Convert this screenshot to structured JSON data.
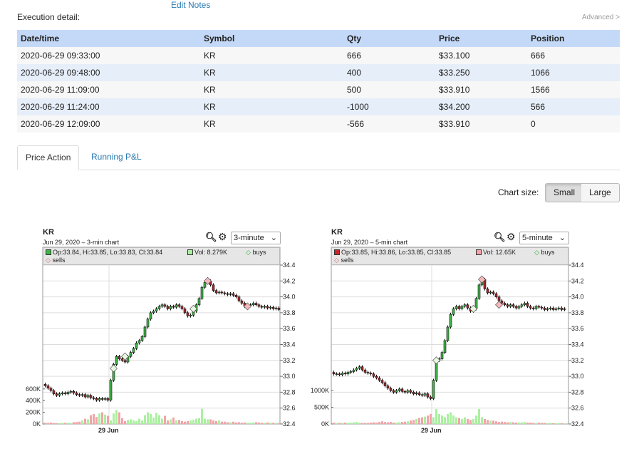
{
  "header": {
    "edit_notes": "Edit Notes",
    "execution_label": "Execution detail:",
    "advanced_link": "Advanced >"
  },
  "table": {
    "columns": [
      "Date/time",
      "Symbol",
      "Qty",
      "Price",
      "Position"
    ],
    "rows": [
      [
        "2020-06-29 09:33:00",
        "KR",
        "666",
        "$33.100",
        "666"
      ],
      [
        "2020-06-29 09:48:00",
        "KR",
        "400",
        "$33.250",
        "1066"
      ],
      [
        "2020-06-29 11:09:00",
        "KR",
        "500",
        "$33.910",
        "1566"
      ],
      [
        "2020-06-29 11:24:00",
        "KR",
        "-1000",
        "$34.200",
        "566"
      ],
      [
        "2020-06-29 12:09:00",
        "KR",
        "-566",
        "$33.910",
        "0"
      ]
    ]
  },
  "tabs": [
    {
      "label": "Price Action",
      "active": true
    },
    {
      "label": "Running P&L",
      "active": false
    }
  ],
  "chart_size": {
    "label": "Chart size:",
    "options": [
      "Small",
      "Large"
    ],
    "selected": "Small"
  },
  "colors": {
    "up": "#3fb548",
    "down": "#a8282c",
    "vol_up": "#aaf0a0",
    "vol_down": "#f2a4a8",
    "header_row": "#c4d9f7",
    "link": "#2a7ab0"
  },
  "chart_data": [
    {
      "type": "candlestick",
      "symbol": "KR",
      "subtitle": "Jun 29, 2020 – 3-min chart",
      "interval": "3-minute",
      "legend": {
        "ohlc": "Op:33.84, Hi:33.85, Lo:33.83, Cl:33.84",
        "vol": "Vol: 8.279K",
        "buys": "buys",
        "sells": "sells",
        "last_color": "#3fb548",
        "last_vol_color": "#aaf0a0"
      },
      "y_ticks": [
        "34.4",
        "34.2",
        "34.0",
        "33.8",
        "33.6",
        "33.4",
        "33.2",
        "33.0",
        "32.8",
        "32.6",
        "32.4"
      ],
      "ylim": [
        32.4,
        34.4
      ],
      "vol_ticks": [
        "600K",
        "400K",
        "200K",
        "0K"
      ],
      "x_label": "29 Jun",
      "premarket_bars": 23,
      "close": [
        32.88,
        32.85,
        32.82,
        32.78,
        32.76,
        32.78,
        32.79,
        32.78,
        32.8,
        32.81,
        32.79,
        32.77,
        32.76,
        32.77,
        32.74,
        32.76,
        32.73,
        32.72,
        32.7,
        32.72,
        32.71,
        32.72,
        32.7,
        32.95,
        33.15,
        33.25,
        33.22,
        33.2,
        33.18,
        33.25,
        33.3,
        33.35,
        33.42,
        33.45,
        33.5,
        33.62,
        33.72,
        33.8,
        33.82,
        33.85,
        33.88,
        33.9,
        33.88,
        33.85,
        33.88,
        33.87,
        33.9,
        33.88,
        33.85,
        33.8,
        33.76,
        33.77,
        33.82,
        33.9,
        33.98,
        34.12,
        34.18,
        34.2,
        34.15,
        34.08,
        34.05,
        34.06,
        34.05,
        34.04,
        34.03,
        34.04,
        34.02,
        34.0,
        33.95,
        33.92,
        33.88,
        33.9,
        33.9,
        33.92,
        33.9,
        33.88,
        33.87,
        33.88,
        33.86,
        33.87,
        33.85,
        33.86,
        33.84
      ],
      "volume_k": [
        20,
        18,
        25,
        15,
        12,
        15,
        18,
        20,
        22,
        15,
        30,
        35,
        40,
        60,
        90,
        80,
        150,
        170,
        120,
        180,
        200,
        160,
        140,
        60,
        180,
        240,
        200,
        100,
        50,
        70,
        80,
        60,
        50,
        90,
        60,
        150,
        200,
        170,
        110,
        190,
        150,
        90,
        140,
        60,
        80,
        110,
        60,
        70,
        50,
        40,
        50,
        60,
        70,
        90,
        100,
        260,
        90,
        80,
        80,
        60,
        50,
        60,
        40,
        40,
        30,
        30,
        40,
        25,
        30,
        20,
        25,
        20,
        20,
        25,
        30,
        25,
        20,
        20,
        25,
        20,
        18,
        20,
        15
      ],
      "buys": [
        {
          "bar": 24,
          "price": 33.1
        },
        {
          "bar": 28,
          "price": 33.25
        },
        {
          "bar": 52,
          "price": 33.85
        }
      ],
      "sells": [
        {
          "bar": 57,
          "price": 34.2
        },
        {
          "bar": 71,
          "price": 33.88
        }
      ]
    },
    {
      "type": "candlestick",
      "symbol": "KR",
      "subtitle": "Jun 29, 2020 – 5-min chart",
      "interval": "5-minute",
      "legend": {
        "ohlc": "Op:33.85, Hi:33.86, Lo:33.85, Cl:33.85",
        "vol": "Vol: 12.65K",
        "buys": "buys",
        "sells": "sells",
        "last_color": "#c8282c",
        "last_vol_color": "#f2a4a8"
      },
      "y_ticks": [
        "34.4",
        "34.2",
        "34.0",
        "33.8",
        "33.6",
        "33.4",
        "33.2",
        "33.0",
        "32.8",
        "32.6",
        "32.4"
      ],
      "ylim": [
        32.4,
        34.4
      ],
      "vol_ticks": [
        "1000K",
        "500K",
        "0K"
      ],
      "x_label": "29 Jun",
      "premarket_bars": 35,
      "close": [
        33.03,
        33.03,
        33.02,
        33.04,
        33.03,
        33.05,
        33.06,
        33.08,
        33.1,
        33.12,
        33.08,
        33.05,
        33.04,
        33.03,
        33.0,
        32.98,
        32.95,
        32.92,
        32.88,
        32.85,
        32.82,
        32.8,
        32.82,
        32.84,
        32.81,
        32.8,
        32.82,
        32.8,
        32.78,
        32.79,
        32.77,
        32.76,
        32.78,
        32.74,
        32.72,
        32.95,
        33.2,
        33.22,
        33.3,
        33.45,
        33.62,
        33.78,
        33.85,
        33.88,
        33.85,
        33.88,
        33.9,
        33.86,
        33.82,
        33.85,
        33.98,
        34.15,
        34.22,
        34.1,
        34.05,
        34.06,
        34.04,
        34.0,
        33.95,
        33.92,
        33.9,
        33.88,
        33.9,
        33.88,
        33.86,
        33.88,
        33.9,
        33.92,
        33.88,
        33.86,
        33.85,
        33.88,
        33.87,
        33.86,
        33.84,
        33.85,
        33.86,
        33.84,
        33.85,
        33.86,
        33.84,
        33.85
      ],
      "volume_k": [
        40,
        30,
        30,
        35,
        40,
        30,
        40,
        50,
        60,
        40,
        30,
        30,
        30,
        40,
        50,
        40,
        60,
        80,
        60,
        50,
        60,
        40,
        40,
        50,
        60,
        70,
        80,
        100,
        120,
        150,
        180,
        200,
        220,
        250,
        300,
        200,
        450,
        300,
        250,
        200,
        300,
        350,
        250,
        200,
        180,
        150,
        200,
        150,
        120,
        150,
        250,
        450,
        200,
        150,
        120,
        100,
        100,
        80,
        60,
        70,
        60,
        50,
        60,
        50,
        40,
        40,
        50,
        60,
        40,
        40,
        30,
        30,
        40,
        30,
        30,
        25,
        30,
        25,
        20,
        25,
        20,
        20
      ],
      "buys": [
        {
          "bar": 36,
          "price": 33.2
        },
        {
          "bar": 49,
          "price": 33.85
        }
      ],
      "sells": [
        {
          "bar": 52,
          "price": 34.22
        },
        {
          "bar": 58,
          "price": 33.9
        }
      ]
    }
  ]
}
